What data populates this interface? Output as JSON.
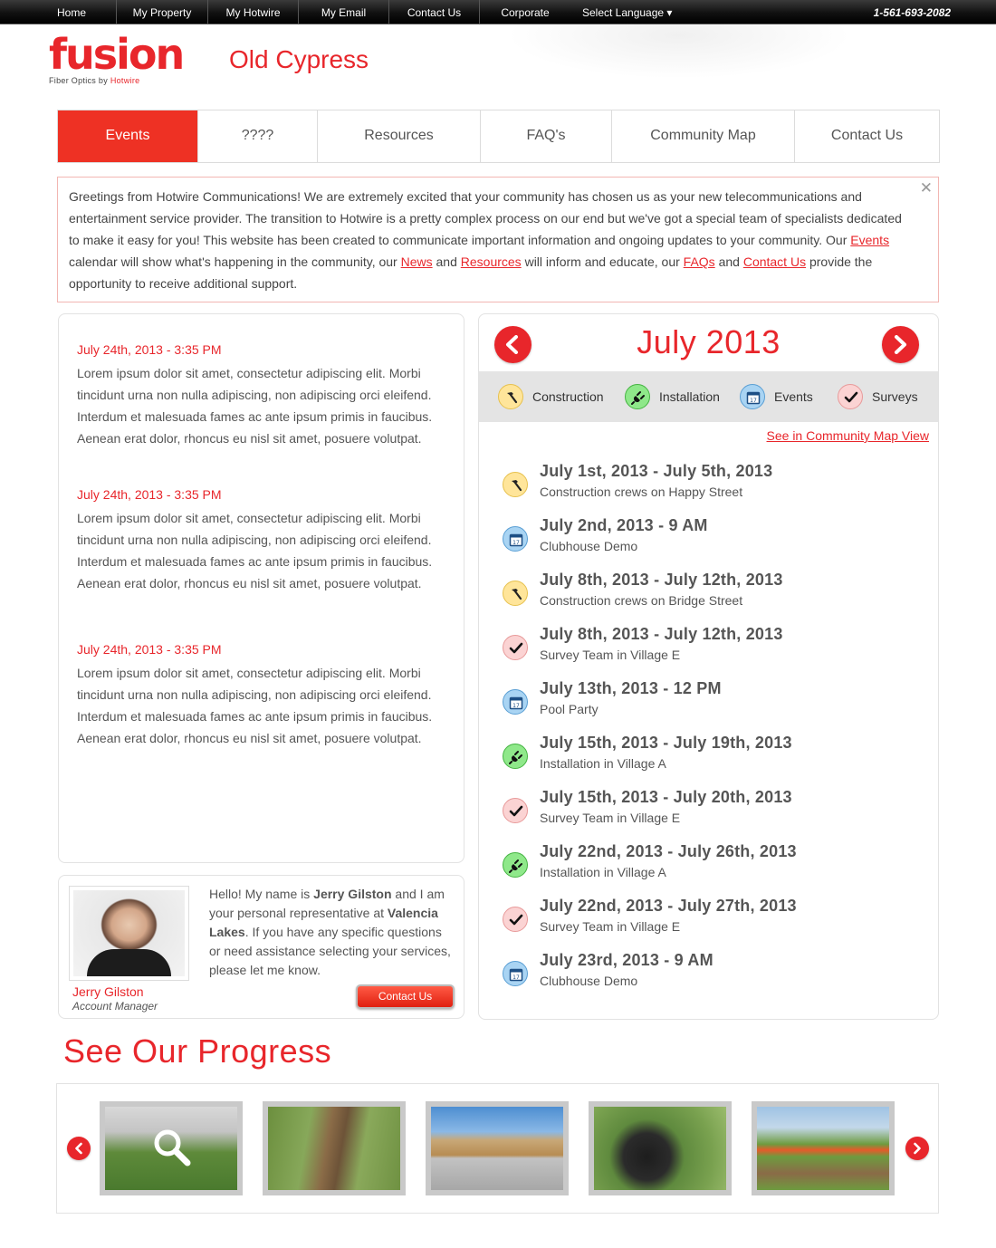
{
  "topbar": {
    "nav": [
      "Home",
      "My Property",
      "My Hotwire",
      "My Email",
      "Contact Us",
      "Corporate"
    ],
    "language": "Select Language ▾",
    "phone": "1-561-693-2082"
  },
  "brand": {
    "logo_word": "fusion",
    "logo_tag_prefix": "Fiber Optics by ",
    "logo_tag_brand": "Hotwire",
    "community": "Old Cypress"
  },
  "mainnav": {
    "tabs": [
      "Events",
      "????",
      "Resources",
      "FAQ's",
      "Community Map",
      "Contact Us"
    ],
    "active": "Events"
  },
  "greeting": {
    "p1": "Greetings from Hotwire Communications!  We are extremely excited that your community has chosen us as your new telecommunications and entertainment service provider.  The transition to Hotwire is a pretty complex process on our end but we've got a special team of specialists dedicated to make it easy for you!  This website has been created to communicate important information and ongoing updates to your community.  Our ",
    "link_events": "Events",
    "p2": " calendar will show what's happening in the community, our ",
    "link_news": "News",
    "p3": " and ",
    "link_resources": "Resources",
    "p4": " will inform and educate, our ",
    "link_faqs": "FAQs",
    "p5": " and ",
    "link_contact": "Contact Us",
    "p6": " provide the opportunity to receive additional support.",
    "close": "✕"
  },
  "news": [
    {
      "date": "July 24th, 2013 - 3:35 PM",
      "body": "Lorem ipsum dolor sit amet, consectetur adipiscing elit. Morbi tincidunt urna non nulla adipiscing, non adipiscing orci eleifend. Interdum et malesuada fames ac ante ipsum primis in faucibus. Aenean erat dolor, rhoncus eu nisl sit amet, posuere volutpat."
    },
    {
      "date": "July 24th, 2013 - 3:35 PM",
      "body": "Lorem ipsum dolor sit amet, consectetur adipiscing elit. Morbi tincidunt urna non nulla adipiscing, non adipiscing orci eleifend. Interdum et malesuada fames ac ante ipsum primis in faucibus. Aenean erat dolor, rhoncus eu nisl sit amet, posuere volutpat."
    },
    {
      "date": "July 24th, 2013 - 3:35 PM",
      "body": "Lorem ipsum dolor sit amet, consectetur adipiscing elit. Morbi tincidunt urna non nulla adipiscing, non adipiscing orci eleifend. Interdum et malesuada fames ac ante ipsum primis in faucibus. Aenean erat dolor, rhoncus eu nisl sit amet, posuere volutpat."
    }
  ],
  "rep": {
    "t1": "Hello! My name is ",
    "name_bold": "Jerry Gilston",
    "t2": " and I am your personal representative at ",
    "community_bold": "Valencia Lakes",
    "t3": ". If you have any specific questions or need assistance selecting your services, please let me know.",
    "name": "Jerry Gilston",
    "role": "Account Manager",
    "button": "Contact Us"
  },
  "calendar": {
    "month": "July 2013",
    "legend": [
      {
        "type": "construction",
        "label": "Construction"
      },
      {
        "type": "installation",
        "label": "Installation"
      },
      {
        "type": "events",
        "label": "Events"
      },
      {
        "type": "surveys",
        "label": "Surveys"
      }
    ],
    "map_link": "See in Community Map View",
    "events": [
      {
        "type": "construction",
        "title": "July 1st, 2013 - July 5th, 2013",
        "desc": "Construction crews on Happy Street"
      },
      {
        "type": "events",
        "title": "July 2nd, 2013 - 9 AM",
        "desc": "Clubhouse Demo"
      },
      {
        "type": "construction",
        "title": "July 8th, 2013 - July 12th, 2013",
        "desc": "Construction crews on Bridge Street"
      },
      {
        "type": "surveys",
        "title": "July 8th, 2013 - July 12th, 2013",
        "desc": "Survey Team in Village E"
      },
      {
        "type": "events",
        "title": "July 13th, 2013 - 12 PM",
        "desc": "Pool Party"
      },
      {
        "type": "installation",
        "title": "July 15th, 2013 - July 19th, 2013",
        "desc": "Installation in Village A"
      },
      {
        "type": "surveys",
        "title": "July 15th, 2013 - July 20th, 2013",
        "desc": "Survey Team in Village E"
      },
      {
        "type": "installation",
        "title": "July 22nd, 2013 - July 26th, 2013",
        "desc": "Installation in Village A"
      },
      {
        "type": "surveys",
        "title": "July 22nd, 2013 - July 27th, 2013",
        "desc": "Survey Team in Village E"
      },
      {
        "type": "events",
        "title": "July 23rd, 2013 - 9 AM",
        "desc": "Clubhouse Demo"
      }
    ]
  },
  "progress": {
    "title": "See Our Progress",
    "photos": [
      "photo-1",
      "photo-2",
      "photo-3",
      "photo-4",
      "photo-5"
    ]
  },
  "colors": {
    "brand_red": "#e8262b",
    "nav_active": "#ee3124",
    "construction": "#ffe59a",
    "installation": "#8fe88a",
    "events": "#a9d4f3",
    "surveys": "#fbd3d3"
  },
  "icons": {
    "construction": "hammer-icon",
    "installation": "plug-icon",
    "events": "calendar-icon",
    "surveys": "checkmark-icon"
  }
}
